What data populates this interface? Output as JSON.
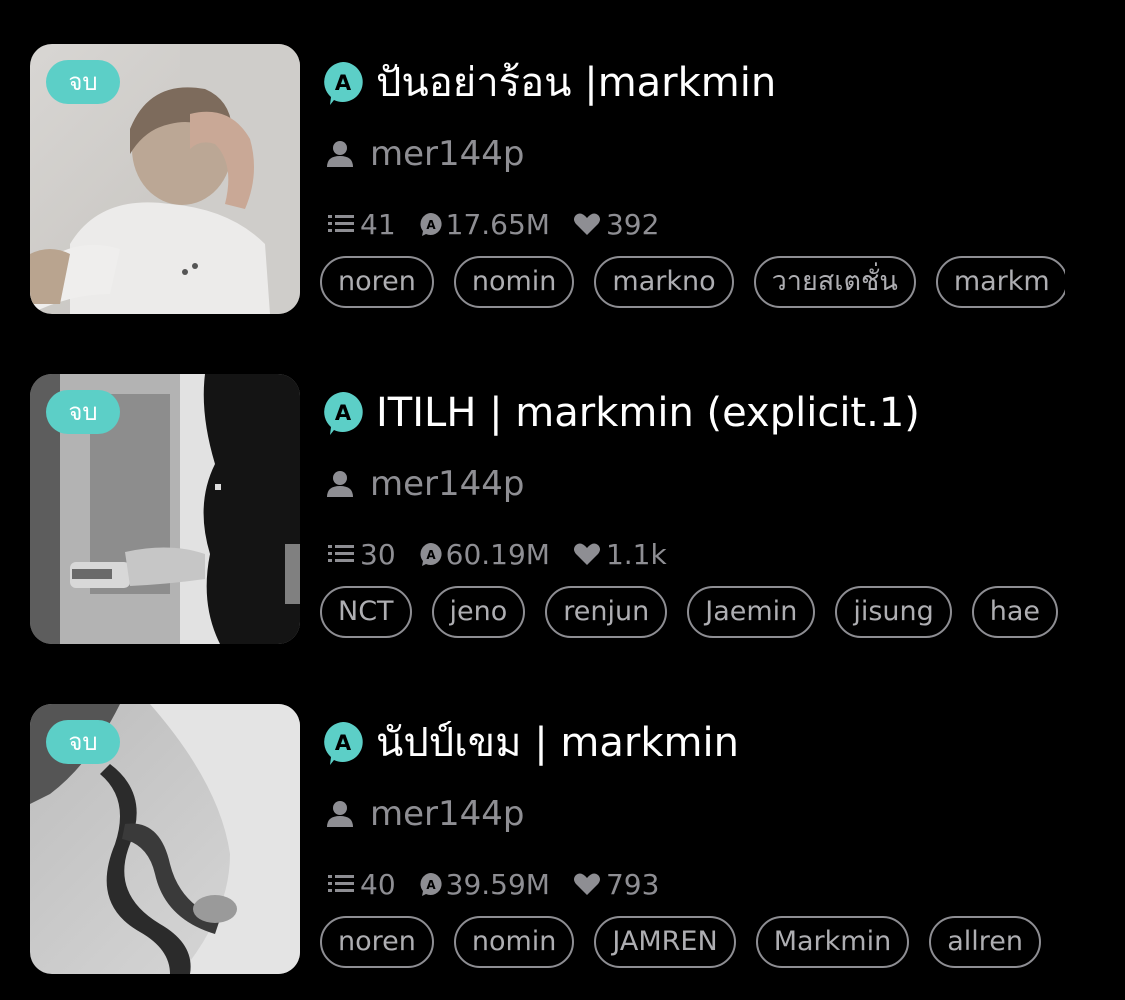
{
  "stories": [
    {
      "badge": "จบ",
      "title": "ปันอย่าร้อน |markmin",
      "author": "mer144p",
      "chapters": "41",
      "views": "17.65M",
      "likes": "392",
      "tags": [
        "noren",
        "nomin",
        "markno",
        "วายสเตชั่น",
        "markm"
      ]
    },
    {
      "badge": "จบ",
      "title": "ITILH | markmin (explicit.1)",
      "author": "mer144p",
      "chapters": "30",
      "views": "60.19M",
      "likes": "1.1k",
      "tags": [
        "NCT",
        "jeno",
        "renjun",
        "Jaemin",
        "jisung",
        "hae"
      ]
    },
    {
      "badge": "จบ",
      "title": "นัปป์เขม | markmin",
      "author": "mer144p",
      "chapters": "40",
      "views": "39.59M",
      "likes": "793",
      "tags": [
        "noren",
        "nomin",
        "JAMREN",
        "Markmin",
        "allren"
      ]
    }
  ],
  "colors": {
    "background": "#000000",
    "badge": "#5ccfc7",
    "app_icon": "#5ccfc7",
    "muted_text": "#8e8e93",
    "tag_border": "#8e8e93"
  },
  "icons": {
    "app": "readawrite-a-icon",
    "author": "user-icon",
    "chapters": "list-icon",
    "views": "comment-bubble-icon",
    "likes": "heart-icon"
  }
}
